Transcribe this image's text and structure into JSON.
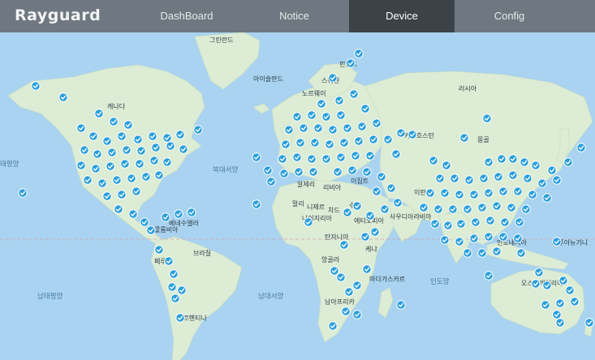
{
  "app": {
    "logo": "Rayguard"
  },
  "nav": {
    "tabs": [
      {
        "label": "DashBoard",
        "active": false
      },
      {
        "label": "Notice",
        "active": false
      },
      {
        "label": "Device",
        "active": true
      },
      {
        "label": "Config",
        "active": false
      }
    ]
  },
  "map": {
    "labels": {
      "greenland": "그린란드",
      "iceland": "아이슬란드",
      "sweden": "스웨덴",
      "finland": "핀란드",
      "norway": "노르웨이",
      "russia": "러시아",
      "canada": "캐나다",
      "kazakhstan": "카자흐스탄",
      "mongolia": "몽골",
      "north_atlantic": "북대서양",
      "south_atlantic": "남대서양",
      "south_pacific": "남태평양",
      "north_pacific": "태평양",
      "indian_ocean": "인도양",
      "algeria": "알제리",
      "libya": "리비아",
      "egypt": "이집트",
      "mali": "말리",
      "niger": "니제르",
      "chad": "차드",
      "nigeria": "나이지리아",
      "sudan": "수단",
      "ethiopia": "에티오피아",
      "kenya": "케냐",
      "tanzania": "탄자니아",
      "angola": "앙골라",
      "madagascar": "마다가스카르",
      "south_africa": "남아프리카",
      "venezuela": "베네수엘라",
      "colombia": "콜롬비아",
      "brazil": "브라질",
      "peru": "페루",
      "argentina": "아르헨티나",
      "indonesia": "인도네시아",
      "australia": "오스트레일리아",
      "papua": "파푸아뉴기니",
      "saudi": "사우디아라비아",
      "iran": "이란"
    },
    "marker_icon": "check-marker-icon",
    "marker_color": "#2a9fdc",
    "water_color": "#a9d3f0",
    "land_color": "#dcecd5"
  }
}
